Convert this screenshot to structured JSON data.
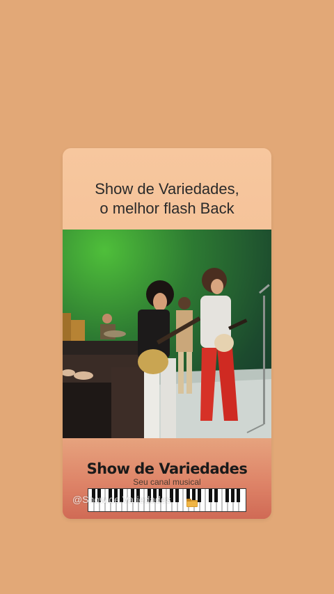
{
  "card": {
    "title_line1": "Show de Variedades,",
    "title_line2": "o melhor flash Back"
  },
  "video": {
    "description_icon": "concert-video-frame"
  },
  "footer": {
    "brand": "Show de Variedades",
    "tagline": "Seu canal musical",
    "handle": "@Show.de.Variedades"
  },
  "colors": {
    "background": "#E2A877",
    "card_top": "#F7C79E",
    "card_bottom": "#D06A55",
    "stage_green": "#2d7a32"
  }
}
